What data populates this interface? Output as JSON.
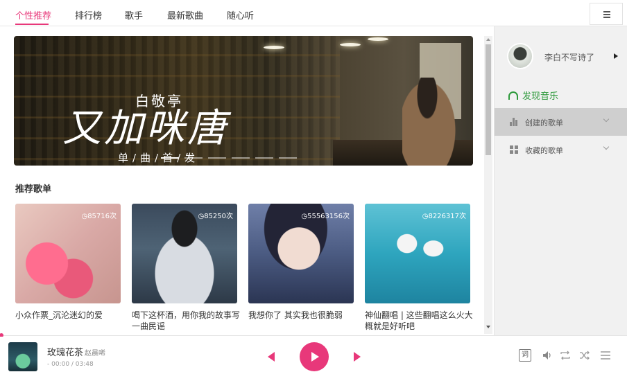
{
  "nav": {
    "tabs": [
      {
        "label": "个性推荐",
        "active": true
      },
      {
        "label": "排行榜",
        "active": false
      },
      {
        "label": "歌手",
        "active": false
      },
      {
        "label": "最新歌曲",
        "active": false
      },
      {
        "label": "随心听",
        "active": false
      }
    ],
    "menu_icon": "hamburger-icon"
  },
  "banner": {
    "artist": "白敬亭",
    "title": "又加咪唐",
    "subtitle": "单/曲/首/发",
    "slide_count": 6,
    "active_slide": 0
  },
  "recommend": {
    "title": "推荐歌单",
    "playlists": [
      {
        "count": "85716次",
        "name": "小众作票_沉沦迷幻的爱"
      },
      {
        "count": "85250次",
        "name": "喝下这杯酒，用你我的故事写一曲民谣"
      },
      {
        "count": "55563156次",
        "name": "我想你了 其实我也很脆弱"
      },
      {
        "count": "8226317次",
        "name": "神仙翻唱 | 这些翻唱这么火大概就是好听吧"
      }
    ]
  },
  "sidebar": {
    "username": "李白不写诗了",
    "discover": "发现音乐",
    "menus": [
      {
        "label": "创建的歌单",
        "icon": "bar-chart-icon",
        "selected": true
      },
      {
        "label": "收藏的歌单",
        "icon": "grid-icon",
        "selected": false
      }
    ]
  },
  "player": {
    "song_title": "玫瑰花茶",
    "artist": "赵晨唏",
    "time": "- 00:00 / 03:48",
    "lyric_label": "词",
    "progress": 0.0
  },
  "colors": {
    "accent": "#e8387a",
    "discover_green": "#2e9a3c"
  }
}
